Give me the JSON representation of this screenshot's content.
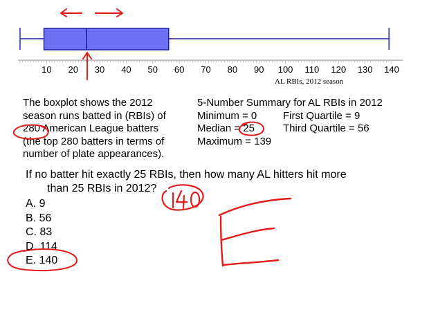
{
  "chart_data": {
    "type": "boxplot",
    "xlabel": "AL RBIs, 2012 season",
    "xlim": [
      0,
      140
    ],
    "ticks": [
      10,
      20,
      30,
      40,
      50,
      60,
      70,
      80,
      90,
      100,
      110,
      120,
      130,
      140
    ],
    "min": 0,
    "q1": 9,
    "median": 25,
    "q3": 56,
    "max": 139
  },
  "problem": {
    "description_lines": [
      "The boxplot shows the 2012",
      "season runs batted in (RBIs) of",
      "280 American League batters",
      "(the top 280 batters in terms of",
      "number of plate appearances)."
    ],
    "summary_title": "5-Number Summary for AL RBIs in 2012",
    "summary_min": "Minimum = 0",
    "summary_median": "Median = 25",
    "summary_max": "Maximum = 139",
    "summary_q1": "First Quartile = 9",
    "summary_q3": "Third Quartile = 56",
    "question_line1": "If no batter hit exactly 25 RBIs, then how many AL hitters hit more",
    "question_line2": "than 25 RBIs in 2012?",
    "choices": [
      "A. 9",
      "B. 56",
      "C. 83",
      "D. 114",
      "E. 140"
    ]
  },
  "annotations": {
    "handwritten_answer": "140",
    "handwritten_letter": "E"
  },
  "colors": {
    "box_fill": "#6f6ff2",
    "box_stroke": "#1a1aa8",
    "whisker": "#1a1aa8",
    "ink": "#e31b1b"
  }
}
